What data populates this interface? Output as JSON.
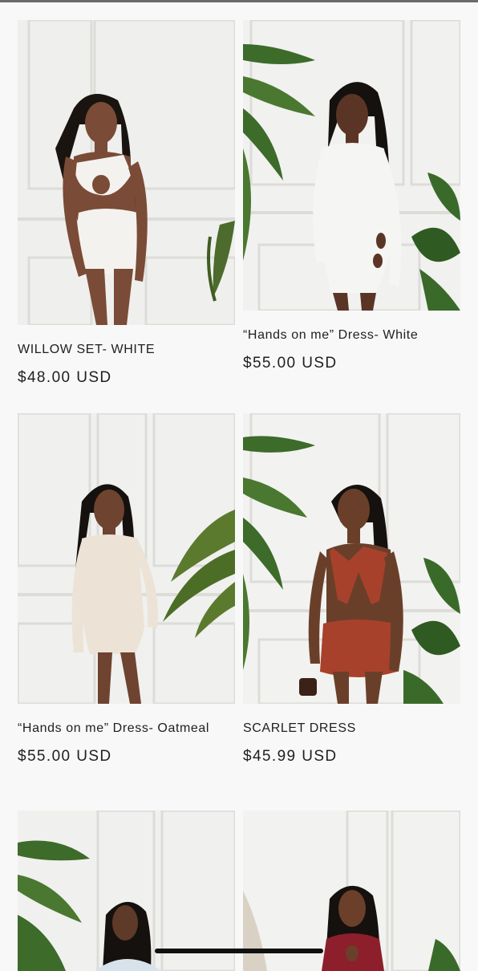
{
  "products": [
    {
      "title": "WILLOW SET- WHITE",
      "price": "$48.00 USD",
      "image": "model-white-cutout-set",
      "outfit_color": "#f4f2ee",
      "skin_color": "#7a4b36"
    },
    {
      "title": "“Hands on me” Dress- White",
      "price": "$55.00 USD",
      "image": "model-white-long-sleeve-dress",
      "outfit_color": "#f5f5f3",
      "skin_color": "#5a3526"
    },
    {
      "title": "“Hands on me” Dress- Oatmeal",
      "price": "$55.00 USD",
      "image": "model-oatmeal-long-sleeve-dress",
      "outfit_color": "#ece3d6",
      "skin_color": "#6e4330"
    },
    {
      "title": "SCARLET DRESS",
      "price": "$45.99 USD",
      "image": "model-scarlet-halter-dress",
      "outfit_color": "#a8412b",
      "skin_color": "#6a3f2a"
    },
    {
      "title": "",
      "price": "",
      "image": "model-light-blue-halter-set",
      "outfit_color": "#d8e2ea",
      "skin_color": "#5e3a28"
    },
    {
      "title": "",
      "price": "",
      "image": "model-red-cutout-dress",
      "outfit_color": "#8c1f2b",
      "skin_color": "#6b3f2a"
    }
  ]
}
